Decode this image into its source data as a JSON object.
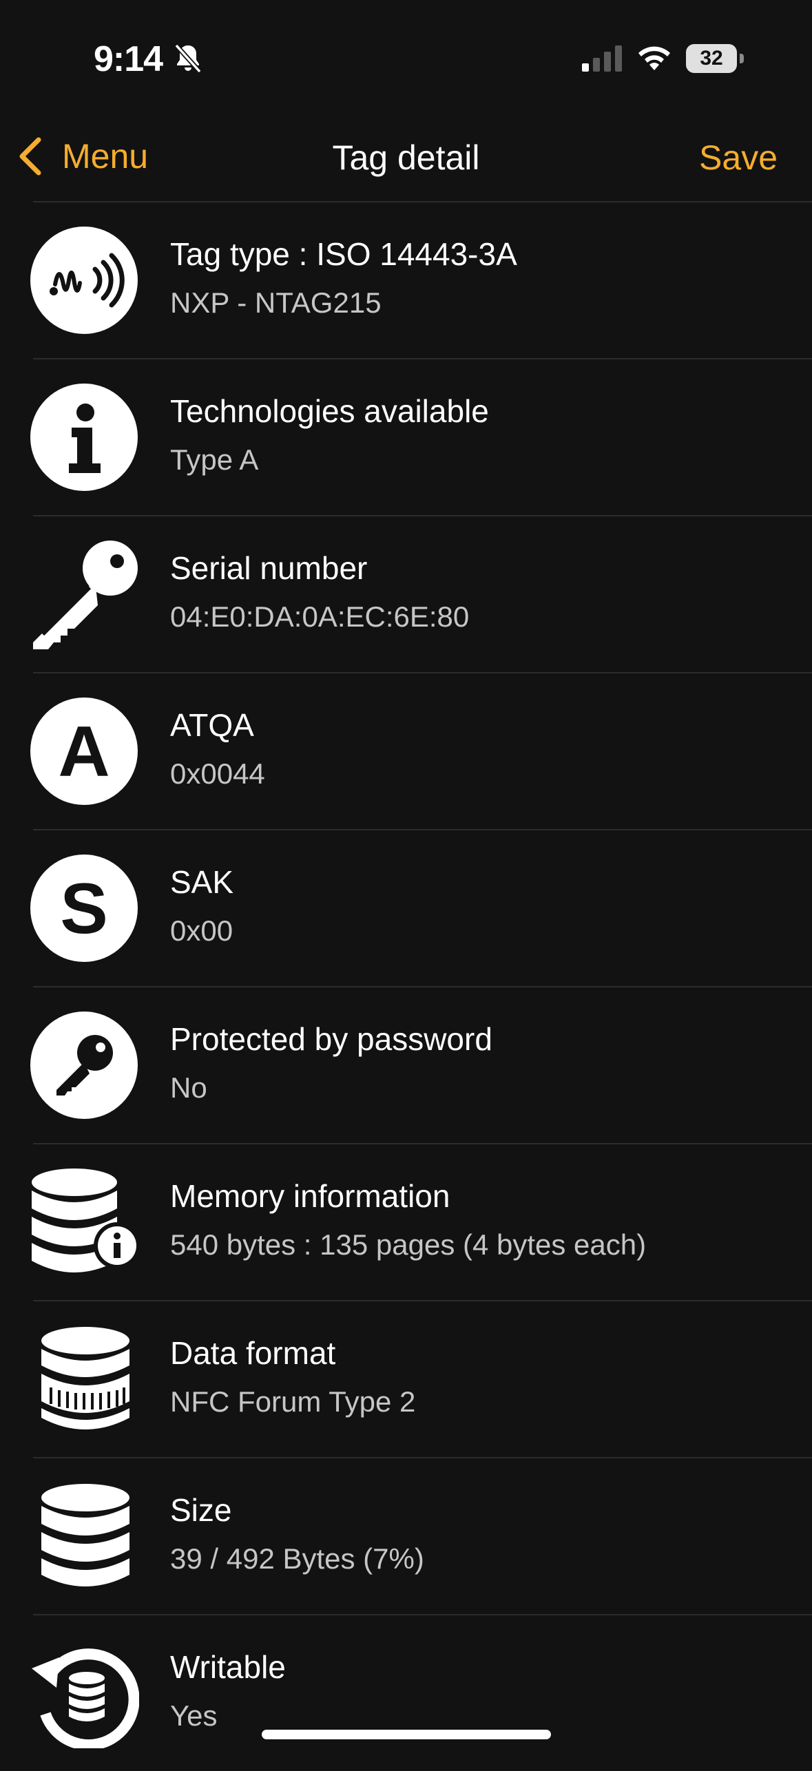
{
  "status_bar": {
    "time": "9:14",
    "battery": "32"
  },
  "nav": {
    "back_label": "Menu",
    "title": "Tag detail",
    "save_label": "Save"
  },
  "accent_color": "#f5ad2e",
  "rows": [
    {
      "icon": "nfc-wave-icon",
      "title": "Tag type : ISO 14443-3A",
      "value": "NXP - NTAG215"
    },
    {
      "icon": "info-icon",
      "title": "Technologies available",
      "value": "Type A"
    },
    {
      "icon": "key-icon",
      "title": "Serial number",
      "value": "04:E0:DA:0A:EC:6E:80"
    },
    {
      "icon": "letter-a-icon",
      "title": "ATQA",
      "value": "0x0044"
    },
    {
      "icon": "letter-s-icon",
      "title": "SAK",
      "value": "0x00"
    },
    {
      "icon": "password-key-icon",
      "title": "Protected by password",
      "value": "No"
    },
    {
      "icon": "database-info-icon",
      "title": "Memory information",
      "value": "540 bytes : 135 pages (4 bytes each)"
    },
    {
      "icon": "database-format-icon",
      "title": "Data format",
      "value": "NFC Forum Type 2"
    },
    {
      "icon": "database-icon",
      "title": "Size",
      "value": "39 / 492 Bytes (7%)"
    },
    {
      "icon": "database-refresh-icon",
      "title": "Writable",
      "value": "Yes"
    }
  ]
}
